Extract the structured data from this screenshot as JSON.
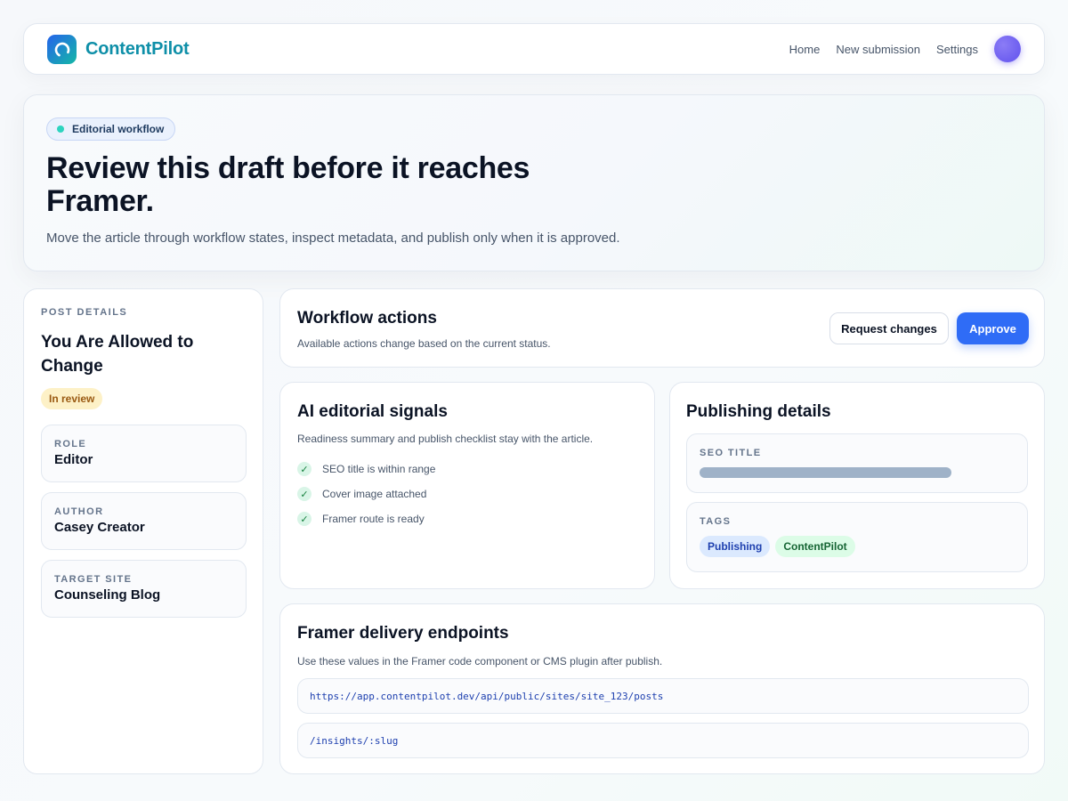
{
  "brand": {
    "name": "ContentPilot",
    "logo_icon": "circular-logo-icon",
    "accent": "#0e8fa8"
  },
  "nav": {
    "links": [
      "Home",
      "New submission",
      "Settings"
    ],
    "avatar_color": "#6d5ef0"
  },
  "hero": {
    "pill": "Editorial workflow",
    "title": "Review this draft before it reaches Framer.",
    "subtitle": "Move the article through workflow states, inspect metadata, and publish only when it is approved."
  },
  "post": {
    "section_label": "POST DETAILS",
    "title": "You Are Allowed to Change",
    "status": "In review",
    "meta": [
      {
        "label": "ROLE",
        "value": "Editor"
      },
      {
        "label": "AUTHOR",
        "value": "Casey Creator"
      },
      {
        "label": "TARGET SITE",
        "value": "Counseling Blog"
      }
    ]
  },
  "workflow": {
    "title": "Workflow actions",
    "subtitle": "Available actions change based on the current status.",
    "request_changes_label": "Request changes",
    "approve_label": "Approve",
    "primary_color": "#2f6cf6"
  },
  "signals": {
    "title": "AI editorial signals",
    "subtitle": "Readiness summary and publish checklist stay with the article.",
    "checks": [
      "SEO title is within range",
      "Cover image attached",
      "Framer route is ready"
    ],
    "check_icon": "✓"
  },
  "publishing": {
    "title": "Publishing details",
    "seo_label": "SEO TITLE",
    "tags_label": "TAGS",
    "tags": [
      "Publishing",
      "ContentPilot"
    ]
  },
  "endpoints": {
    "title": "Framer delivery endpoints",
    "subtitle": "Use these values in the Framer code component or CMS plugin after publish.",
    "api_url": "https://app.contentpilot.dev/api/public/sites/site_123/posts",
    "route": "/insights/:slug"
  }
}
